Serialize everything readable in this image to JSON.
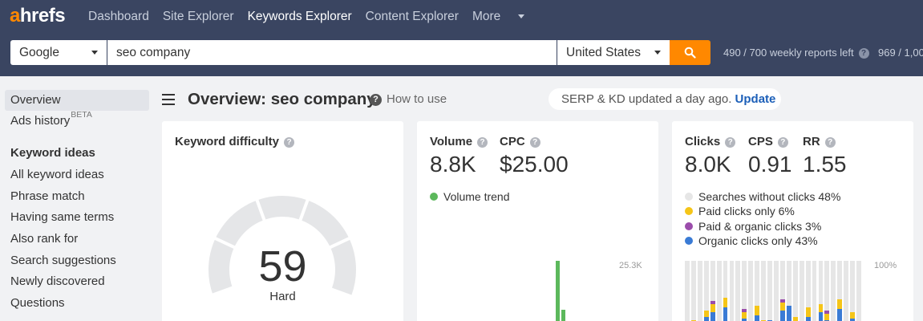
{
  "app": {
    "logo_a": "a",
    "logo_rest": "hrefs"
  },
  "nav": {
    "items": [
      "Dashboard",
      "Site Explorer",
      "Keywords Explorer",
      "Content Explorer",
      "More"
    ]
  },
  "search": {
    "engine": "Google",
    "query": "seo company",
    "country": "United States",
    "button_icon": "search-icon",
    "reports_left": "490 / 700 weekly reports left",
    "reports_right": "969 / 1,00"
  },
  "sidebar": {
    "overview": "Overview",
    "ads_history": "Ads history",
    "ads_badge": "BETA",
    "section_title": "Keyword ideas",
    "items": [
      "All keyword ideas",
      "Phrase match",
      "Having same terms",
      "Also rank for",
      "Search suggestions",
      "Newly discovered",
      "Questions"
    ]
  },
  "header": {
    "title": "Overview: seo company",
    "how_to": "How to use",
    "serp_notice": "SERP & KD updated a day ago.",
    "update": "Update"
  },
  "kd_card": {
    "label": "Keyword difficulty",
    "value": "59",
    "rating": "Hard",
    "gauge_level": 0.59
  },
  "volume_card": {
    "volume_label": "Volume",
    "volume_value": "8.8K",
    "cpc_label": "CPC",
    "cpc_value": "$25.00",
    "trend_legend": "Volume trend",
    "axis_max": "25.3K",
    "trend_color": "#5cb85c"
  },
  "clicks_card": {
    "clicks_label": "Clicks",
    "clicks_value": "8.0K",
    "cps_label": "CPS",
    "cps_value": "0.91",
    "rr_label": "RR",
    "rr_value": "1.55",
    "legend": [
      {
        "label": "Searches without clicks 48%",
        "color": "#e6e6e6"
      },
      {
        "label": "Paid clicks only 6%",
        "color": "#f5c518"
      },
      {
        "label": "Paid & organic clicks 3%",
        "color": "#9b4dab"
      },
      {
        "label": "Organic clicks only 43%",
        "color": "#3a7bd5"
      }
    ],
    "axis_max": "100%"
  }
}
